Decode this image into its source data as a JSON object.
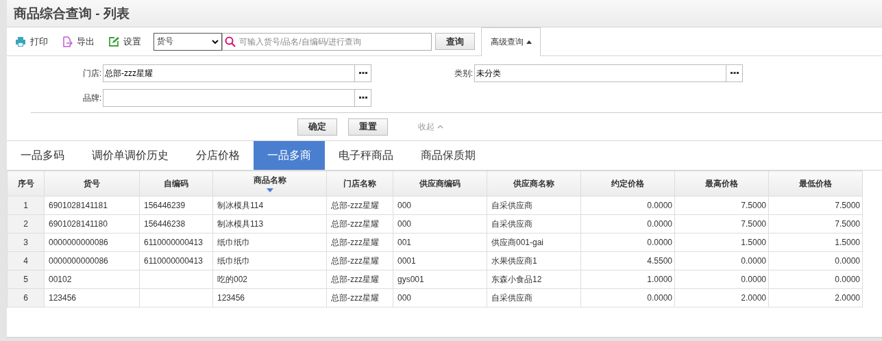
{
  "window": {
    "title": "商品综合查询 - 列表"
  },
  "toolbar": {
    "buttons": [
      {
        "label": "打印",
        "kind": "print"
      },
      {
        "label": "导出",
        "kind": "export"
      },
      {
        "label": "设置",
        "kind": "settings"
      }
    ],
    "search_type": "货号",
    "search": {
      "placeholder": "可输入货号/品名/自编码/进行查询"
    },
    "search_button": "查询",
    "advanced_button": {
      "label": "高级查询",
      "expanded": true
    }
  },
  "filters": [
    {
      "label": "门店:",
      "value": "总部-zzz星耀"
    },
    {
      "label": "类别:",
      "value": "未分类"
    },
    {
      "label": "品牌:"
    }
  ],
  "filter_actions": {
    "confirm": "确定",
    "reset": "重置",
    "collapse": "收起"
  },
  "tabs": [
    {
      "label": "一品多码",
      "selected": false
    },
    {
      "label": "调价单调价历史",
      "selected": false
    },
    {
      "label": "分店价格",
      "selected": false
    },
    {
      "label": "一品多商",
      "selected": true
    },
    {
      "label": "电子秤商品",
      "selected": false
    },
    {
      "label": "商品保质期",
      "selected": false
    }
  ],
  "table": {
    "columns": [
      {
        "title": "序号",
        "sorted": false
      },
      {
        "title": "货号",
        "sorted": false
      },
      {
        "title": "自编码",
        "sorted": false
      },
      {
        "title": "商品名称",
        "sorted": true
      },
      {
        "title": "门店名称",
        "sorted": false
      },
      {
        "title": "供应商编码",
        "sorted": false
      },
      {
        "title": "供应商名称",
        "sorted": false
      },
      {
        "title": "约定价格",
        "sorted": false
      },
      {
        "title": "最高价格",
        "sorted": false
      },
      {
        "title": "最低价格",
        "sorted": false
      }
    ],
    "rows": [
      [
        "1",
        "6901028141181",
        "156446239",
        "制冰模具114",
        "总部-zzz星耀",
        "000",
        "自采供应商",
        "0.0000",
        "7.5000",
        "7.5000"
      ],
      [
        "2",
        "6901028141180",
        "156446238",
        "制冰模具113",
        "总部-zzz星耀",
        "000",
        "自采供应商",
        "0.0000",
        "7.5000",
        "7.5000"
      ],
      [
        "3",
        "0000000000086",
        "6110000000413",
        "纸巾纸巾",
        "总部-zzz星耀",
        "001",
        "供应商001-gai",
        "0.0000",
        "1.5000",
        "1.5000"
      ],
      [
        "4",
        "0000000000086",
        "6110000000413",
        "纸巾纸巾",
        "总部-zzz星耀",
        "0001",
        "水果供应商1",
        "4.5500",
        "0.0000",
        "0.0000"
      ],
      [
        "5",
        "00102",
        "",
        "吃的002",
        "总部-zzz星耀",
        "gys001",
        "东森小食品12",
        "1.0000",
        "0.0000",
        "0.0000"
      ],
      [
        "6",
        "123456",
        "",
        "123456",
        "总部-zzz星耀",
        "000",
        "自采供应商",
        "0.0000",
        "2.0000",
        "2.0000"
      ]
    ]
  }
}
